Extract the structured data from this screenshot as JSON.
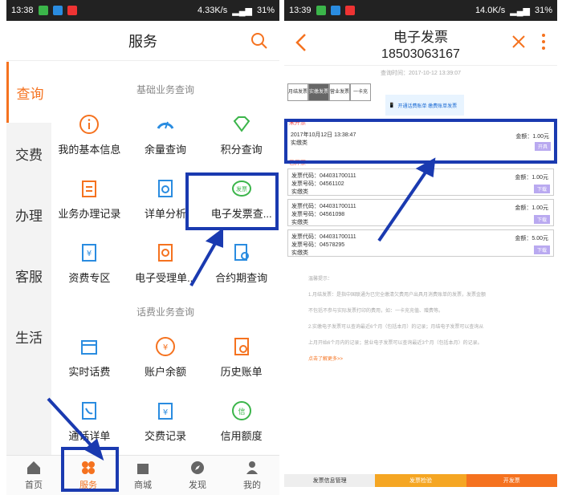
{
  "left": {
    "status": {
      "time": "13:38",
      "speed": "4.33K/s",
      "battery": "31%"
    },
    "title": "服务",
    "nav": [
      "查询",
      "交费",
      "办理",
      "客服",
      "生活"
    ],
    "section1": "基础业务查询",
    "section2": "话费业务查询",
    "grid1": [
      "我的基本信息",
      "余量查询",
      "积分查询",
      "业务办理记录",
      "详单分析",
      "电子发票查...",
      "资费专区",
      "电子受理单...",
      "合约期查询"
    ],
    "grid2": [
      "实时话费",
      "账户余额",
      "历史账单",
      "通话详单",
      "交费记录",
      "信用额度"
    ],
    "tabs": [
      "首页",
      "服务",
      "商城",
      "发现",
      "我的"
    ]
  },
  "right": {
    "status": {
      "time": "13:39",
      "speed": "14.0K/s",
      "battery": "31%"
    },
    "title": "电子发票",
    "phone": "18503063167",
    "query_time": "查询时间：2017-10-12 13:39:07",
    "tabs": [
      "月结发票",
      "实缴发票",
      "营业发票",
      "一卡充"
    ],
    "banner": "开通话费账单 缴费账单发票",
    "unissued_label": "未开票",
    "issued_label": "已开票",
    "unissued": [
      {
        "line1": "2017年10月12日 13:38:47",
        "line2": "实缴类",
        "amount": "金额：1.00元",
        "btn": "开具"
      }
    ],
    "issued": [
      {
        "line1": "发票代码：044031700111",
        "line2": "发票号码：04561102",
        "line3": "实缴类",
        "amount": "金额：1.00元",
        "btn": "下载"
      },
      {
        "line1": "发票代码：044031700111",
        "line2": "发票号码：04561098",
        "line3": "实缴类",
        "amount": "金额：1.00元",
        "btn": "下载"
      },
      {
        "line1": "发票代码：044031700111",
        "line2": "发票号码：04578295",
        "line3": "实缴类",
        "amount": "金额：5.00元",
        "btn": "下载"
      }
    ],
    "tips_title": "温馨提示：",
    "tips": [
      "1.月结发票：是指中国联通为已完全缴清欠费用户出具月消费账单的发票，发票金额",
      "不包括不参与实际发票打印的费用，如：一卡充充值、赠费等。",
      "2.实缴电子发票可以查询最近6个月（包括本月）的记录；月结电子发票可以查询从",
      "上月开始6个月内的记录；营业电子发票可以查询最近3个月（包括本月）的记录。"
    ],
    "tips_link": "点击了解更多>>",
    "bottom": [
      "发票信息管理",
      "发票检验",
      "开发票"
    ]
  }
}
